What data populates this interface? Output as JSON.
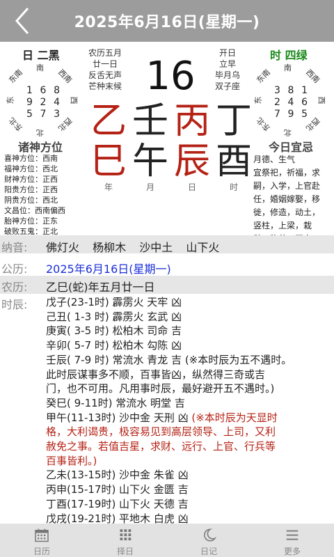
{
  "header": {
    "title": "2025年6月16日(星期一)"
  },
  "top": {
    "day_title": "日 二黑",
    "hour_title": "时 四绿",
    "lunar_left": [
      "农历五月",
      "廿一日",
      "反舌无声",
      "芒种末候"
    ],
    "lunar_right": [
      "开日",
      "立早",
      "毕月乌",
      "双子座"
    ],
    "day_number": "16",
    "ganzhi_top": [
      "乙",
      "壬",
      "丙",
      "丁"
    ],
    "ganzhi_bottom": [
      "巳",
      "午",
      "辰",
      "酉"
    ],
    "ganzhi_labels": [
      "年",
      "月",
      "日",
      "时"
    ],
    "compass_dirs": {
      "n": "南",
      "ne": "西南",
      "e": "西",
      "se": "西北",
      "s": "北",
      "sw": "东北",
      "w": "东",
      "nw": "东南"
    },
    "day_grid": [
      [
        "1",
        "6",
        "8"
      ],
      [
        "9",
        "2",
        "4"
      ],
      [
        "5",
        "7",
        "3"
      ]
    ],
    "hour_grid": [
      [
        "3",
        "8",
        "1"
      ],
      [
        "2",
        "4",
        "6"
      ],
      [
        "7",
        "9",
        "5"
      ]
    ],
    "gods_title": "诸神方位",
    "gods": [
      "喜神方位：西南",
      "福神方位：西北",
      "财神方位：正西",
      "阳贵方位：正西",
      "阴贵方位：西北",
      "文昌位：西南偏西",
      "胎神方位：正东",
      "破败五鬼：正北"
    ],
    "yiji_title": "今日宜忌",
    "yiji_lines": [
      "月德、生气",
      "宜祭祀，祈福，求",
      "嗣，入学，上官赴",
      "任，婚姻嫁娶，移",
      "徙，修造，动土，",
      "竖柱，上梁，栽",
      "种，牧养，开市。"
    ]
  },
  "nayin": {
    "label": "纳音:",
    "items": [
      "佛灯火",
      "杨柳木",
      "沙中土",
      "山下火"
    ]
  },
  "gongli": {
    "label": "公历:",
    "value": "2025年6月16日(星期一)"
  },
  "nongli": {
    "label": "农历:",
    "value": "乙巳(蛇)年五月廿一日"
  },
  "shichen": {
    "label": "时辰:",
    "lines": [
      {
        "text": "戊子(23-1时) 霹雳火 天牢 凶",
        "red": false
      },
      {
        "text": "己丑( 1-3 时) 霹雳火 玄武 凶",
        "red": false
      },
      {
        "text": "庚寅( 3-5 时) 松柏木 司命 吉",
        "red": false
      },
      {
        "text": "辛卯( 5-7 时) 松柏木 勾陈 凶",
        "red": false
      },
      {
        "text": "壬辰( 7-9 时) 常流水 青龙 吉 (※本时辰为五不遇时。",
        "red": false
      },
      {
        "text": "此时辰谋事多不顺，百事皆凶，纵然得三奇或吉",
        "red": false
      },
      {
        "text": "门，也不可用。凡用事时辰，最好避开五不遇时。)",
        "red": false
      },
      {
        "text": "癸巳( 9-11时) 常流水 明堂 吉",
        "red": false
      },
      {
        "text": "甲午(11-13时) 沙中金 天刑 凶 ",
        "red": false,
        "extra": "(※本时辰为天显时"
      },
      {
        "text": "格，大利谒贵，极容易见到高层领导、上司，又利",
        "red": true
      },
      {
        "text": "赦免之事。若值吉星，求财、远行、上官、行兵等",
        "red": true
      },
      {
        "text": "百事皆利。)",
        "red": true
      },
      {
        "text": "乙未(13-15时) 沙中金 朱雀 凶",
        "red": false
      },
      {
        "text": "丙申(15-17时) 山下火 金匮 吉",
        "red": false
      },
      {
        "text": "丁酉(17-19时) 山下火 天德 吉",
        "red": false
      },
      {
        "text": "戊戌(19-21时) 平地木 白虎 凶",
        "red": false
      }
    ]
  },
  "bottom_nav": [
    {
      "label": "日历",
      "icon": "calendar-icon"
    },
    {
      "label": "择日",
      "icon": "grid-icon"
    },
    {
      "label": "日记",
      "icon": "moon-icon"
    },
    {
      "label": "更多",
      "icon": "menu-icon"
    }
  ]
}
